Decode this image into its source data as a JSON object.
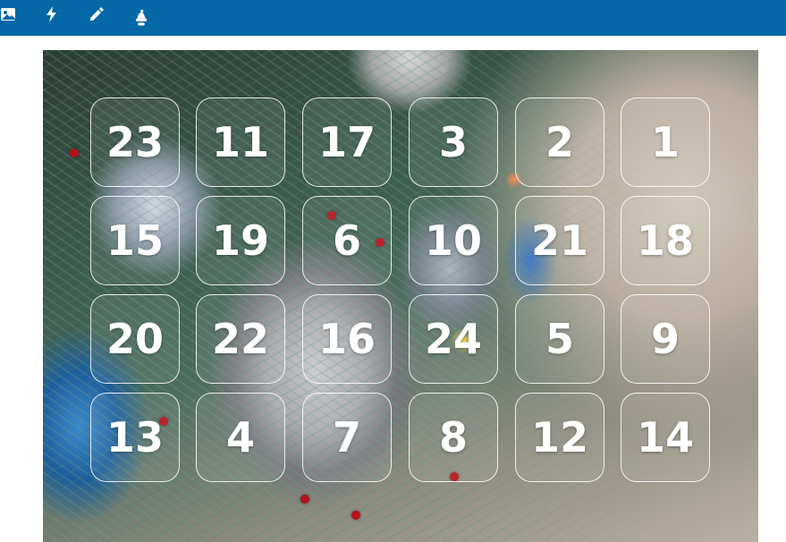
{
  "toolbar": {
    "background": "#0568a6",
    "icons": [
      "image-icon",
      "lightning-icon",
      "pencil-icon",
      "santa-hat-icon"
    ]
  },
  "calendar": {
    "doors": [
      [
        "23",
        "11",
        "17",
        "3",
        "2",
        "1"
      ],
      [
        "15",
        "19",
        "6",
        "10",
        "21",
        "18"
      ],
      [
        "20",
        "22",
        "16",
        "24",
        "5",
        "9"
      ],
      [
        "13",
        "4",
        "7",
        "8",
        "12",
        "14"
      ]
    ]
  }
}
